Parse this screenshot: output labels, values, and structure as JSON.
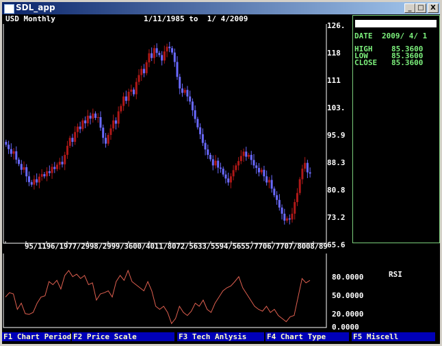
{
  "window": {
    "title": "SDL_app",
    "buttons": [
      "_",
      "□",
      "X"
    ]
  },
  "header": {
    "symbol": "USD Monthly",
    "range": "1/11/1985 to  1/ 4/2009"
  },
  "info": {
    "date_label": "DATE",
    "date": "2009/ 4/ 1",
    "rows": [
      {
        "label": "HIGH",
        "value": "85.3600"
      },
      {
        "label": "LOW",
        "value": "85.3600"
      },
      {
        "label": "CLOSE",
        "value": "85.3600"
      }
    ]
  },
  "price_axis": {
    "ticks": [
      "126.",
      "118",
      "111",
      "103.",
      "95.9",
      "88.3",
      "80.8",
      "73.2",
      "65.6"
    ]
  },
  "x_axis": {
    "labels_text": "95/1196/1977/2998/2999/3600/4011/8072/5633/5594/5655/7706/7707/8008/89"
  },
  "rsi": {
    "label": "RSI",
    "ticks": [
      "80.0000",
      "50.0000",
      "20.0000",
      "0.0000"
    ]
  },
  "footer": {
    "items": [
      "F1 Chart Period",
      "F2 Price Scale",
      "F3 Tech Anlysis",
      "F4 Chart Type",
      "F5 Miscell"
    ]
  },
  "colors": {
    "up": "#b01818",
    "down": "#6a6aff",
    "rsi_line": "#e06050",
    "accent_green": "#7cf07c"
  },
  "chart_data": [
    {
      "type": "candlestick",
      "title": "USD Monthly",
      "ylim": [
        65.6,
        126
      ],
      "closes": [
        93.3,
        92.1,
        90.8,
        91.5,
        89.2,
        88.0,
        86.4,
        87.1,
        84.6,
        83.0,
        82.3,
        83.8,
        82.9,
        84.5,
        85.2,
        84.6,
        86.0,
        85.5,
        87.2,
        86.6,
        87.8,
        88.6,
        87.9,
        90.5,
        93.0,
        95.2,
        94.1,
        96.8,
        98.3,
        97.6,
        100.0,
        99.2,
        101.3,
        100.5,
        101.9,
        100.7,
        100.9,
        98.0,
        95.2,
        93.6,
        96.0,
        97.8,
        100.0,
        99.1,
        102.5,
        104.0,
        106.6,
        105.4,
        107.9,
        108.5,
        107.2,
        110.6,
        112.5,
        114.2,
        113.0,
        116.0,
        118.5,
        117.2,
        119.9,
        118.6,
        118.0,
        116.5,
        119.0,
        120.3,
        119.9,
        118.7,
        116.1,
        112.0,
        108.8,
        107.6,
        108.4,
        106.6,
        105.2,
        102.8,
        100.4,
        98.1,
        96.2,
        93.8,
        92.0,
        90.5,
        89.3,
        87.6,
        88.9,
        87.0,
        86.7,
        85.1,
        84.0,
        82.9,
        84.6,
        86.3,
        87.6,
        88.8,
        90.2,
        91.4,
        90.0,
        90.5,
        89.1,
        87.6,
        86.9,
        85.7,
        86.4,
        84.6,
        82.9,
        83.6,
        81.2,
        79.4,
        78.1,
        76.0,
        74.3,
        72.4,
        73.0,
        72.7,
        74.3,
        77.5,
        80.0,
        83.8,
        86.7,
        88.3,
        85.7,
        85.36
      ]
    },
    {
      "type": "line",
      "title": "RSI",
      "ylim": [
        0,
        80
      ],
      "values": [
        45,
        52,
        50,
        25,
        35,
        18,
        17,
        20,
        35,
        45,
        47,
        70,
        65,
        72,
        58,
        80,
        88,
        78,
        82,
        75,
        80,
        65,
        68,
        40,
        50,
        52,
        55,
        45,
        70,
        80,
        72,
        88,
        70,
        65,
        60,
        55,
        70,
        55,
        30,
        25,
        30,
        20,
        2,
        10,
        30,
        20,
        15,
        22,
        35,
        30,
        40,
        25,
        20,
        35,
        45,
        55,
        60,
        63,
        70,
        78,
        60,
        50,
        40,
        30,
        25,
        22,
        30,
        20,
        25,
        15,
        10,
        5,
        13,
        15,
        45,
        75,
        68,
        72
      ]
    }
  ]
}
